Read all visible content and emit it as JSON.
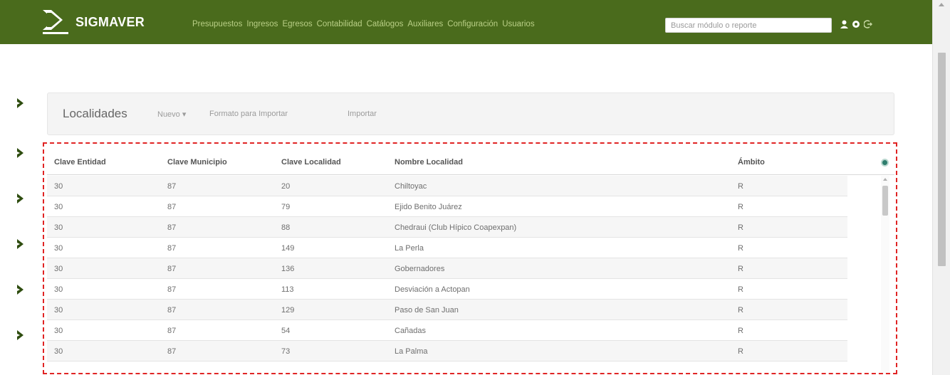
{
  "app": {
    "brand": "SIGMAVER"
  },
  "nav": {
    "items": [
      "Presupuestos",
      "Ingresos",
      "Egresos",
      "Contabilidad",
      "Catálogos",
      "Auxiliares",
      "Configuración",
      "Usuarios"
    ],
    "search_placeholder": "Buscar módulo o reporte",
    "icons": [
      "user-icon",
      "gear-icon",
      "logout-icon"
    ]
  },
  "toolbar": {
    "title": "Localidades",
    "new_label": "Nuevo ▾",
    "format_label": "Formato para Importar",
    "import_label": "Importar"
  },
  "table": {
    "headers": [
      "Clave Entidad",
      "Clave Municipio",
      "Clave Localidad",
      "Nombre Localidad",
      "Ámbito"
    ],
    "rows": [
      [
        "30",
        "87",
        "20",
        "Chiltoyac",
        "R"
      ],
      [
        "30",
        "87",
        "79",
        "Ejido Benito Juárez",
        "R"
      ],
      [
        "30",
        "87",
        "88",
        "Chedraui (Club Hípico Coapexpan)",
        "R"
      ],
      [
        "30",
        "87",
        "149",
        "La Perla",
        "R"
      ],
      [
        "30",
        "87",
        "136",
        "Gobernadores",
        "R"
      ],
      [
        "30",
        "87",
        "113",
        "Desviación a Actopan",
        "R"
      ],
      [
        "30",
        "87",
        "129",
        "Paso de San Juan",
        "R"
      ],
      [
        "30",
        "87",
        "54",
        "Cañadas",
        "R"
      ],
      [
        "30",
        "87",
        "73",
        "La Palma",
        "R"
      ]
    ]
  },
  "colors": {
    "navbar": "#4a6b1c",
    "nav_link": "#b9cf86",
    "chevron": "#2f4d10",
    "highlight_frame": "#e02424"
  }
}
